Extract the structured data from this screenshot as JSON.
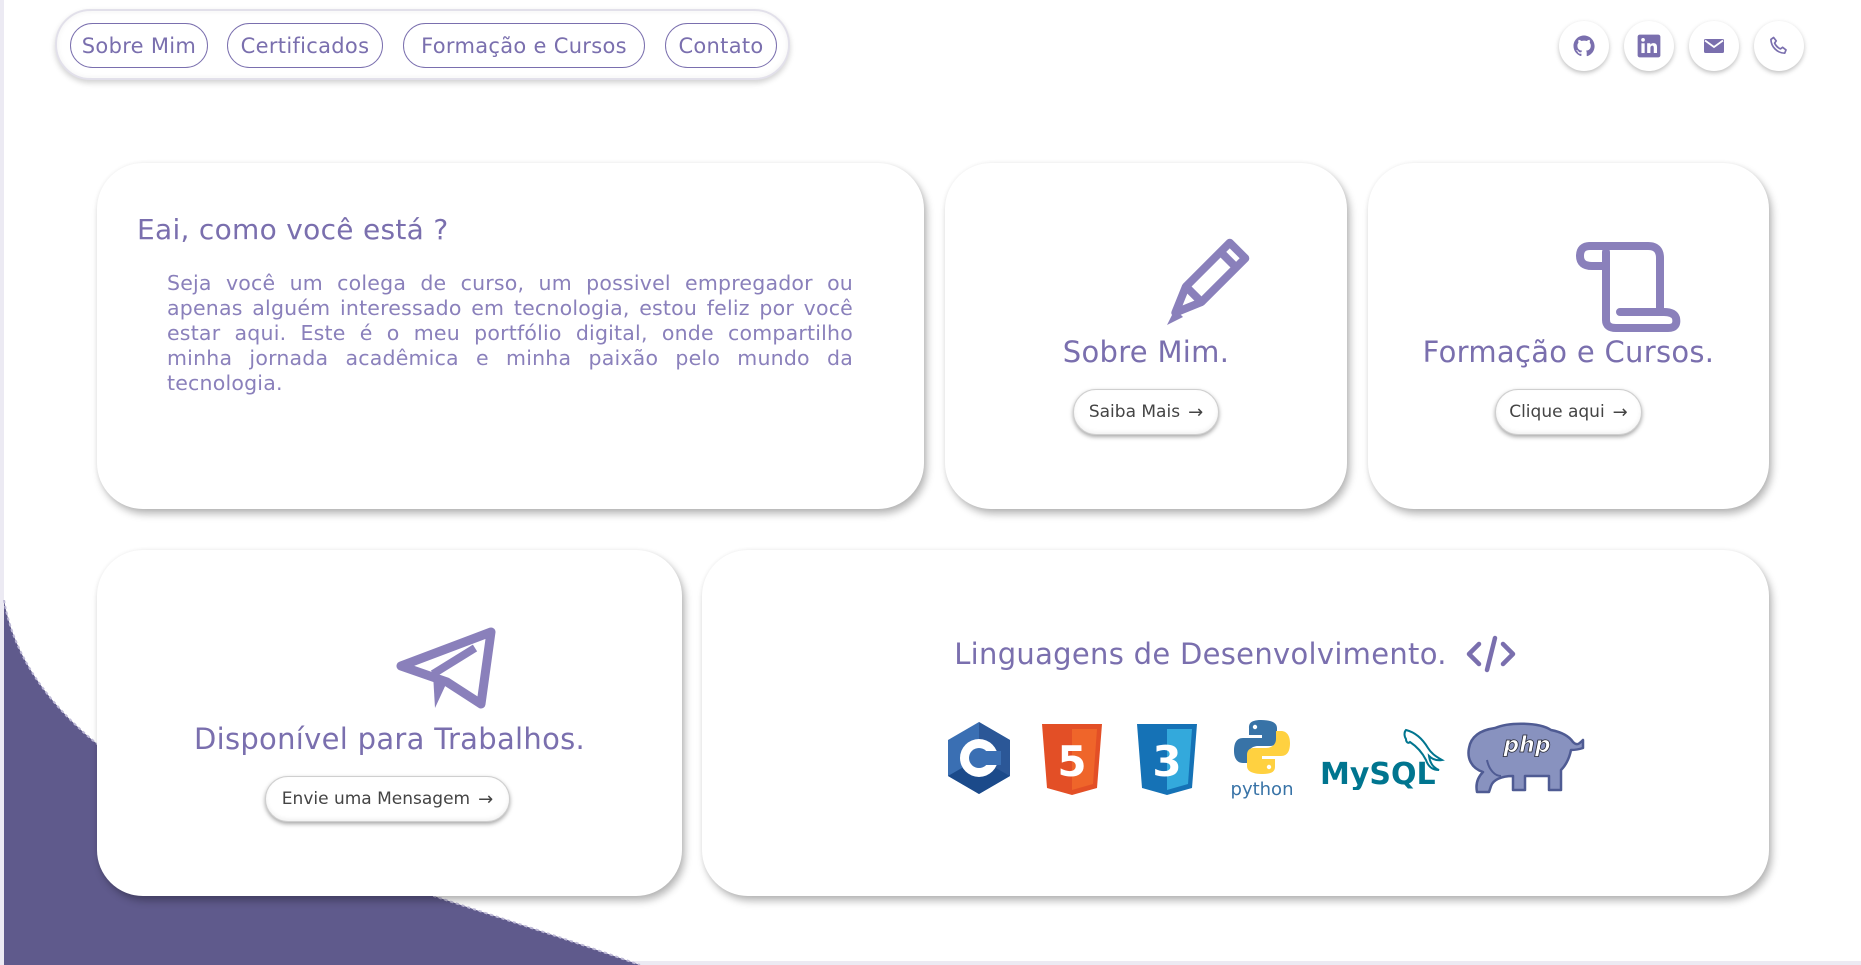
{
  "nav": {
    "items": [
      {
        "label": "Sobre Mim"
      },
      {
        "label": "Certificados"
      },
      {
        "label": "Formação e Cursos"
      },
      {
        "label": "Contato"
      }
    ]
  },
  "social": {
    "icons": [
      "github-icon",
      "linkedin-icon",
      "email-icon",
      "phone-icon"
    ]
  },
  "welcome": {
    "title": "Eai, como você está ?",
    "text": "Seja você um colega de curso, um possivel empregador ou apenas alguém interessado em tecnologia, estou feliz por você estar aqui. Este é o meu portfólio digital, onde compartilho minha jornada acadêmica e minha paixão pelo mundo da tecnologia."
  },
  "about": {
    "title": "Sobre Mim.",
    "button": "Saiba Mais",
    "icon": "pencil-icon"
  },
  "courses": {
    "title": "Formação e Cursos.",
    "button": "Clique aqui",
    "icon": "scroll-icon"
  },
  "work": {
    "title": "Disponível para Trabalhos.",
    "button": "Envie uma Mensagem",
    "icon": "paper-plane-icon"
  },
  "languages": {
    "title": "Linguagens de Desenvolvimento.",
    "icon": "code-icon",
    "logos": [
      {
        "name": "c-logo",
        "text": "C"
      },
      {
        "name": "html5-logo",
        "text": "5"
      },
      {
        "name": "css3-logo",
        "text": "3"
      },
      {
        "name": "python-logo",
        "text": "python"
      },
      {
        "name": "mysql-logo",
        "text": "MySQL"
      },
      {
        "name": "php-logo",
        "text": "php"
      }
    ]
  },
  "colors": {
    "accent": "#7a6fae",
    "wave": "#5f5a8c",
    "html5": "#e34f26",
    "css3": "#1572b6",
    "c": "#3a6fb3",
    "mysql_blue": "#00758f",
    "mysql_orange": "#f29111",
    "php": "#8892bf"
  }
}
